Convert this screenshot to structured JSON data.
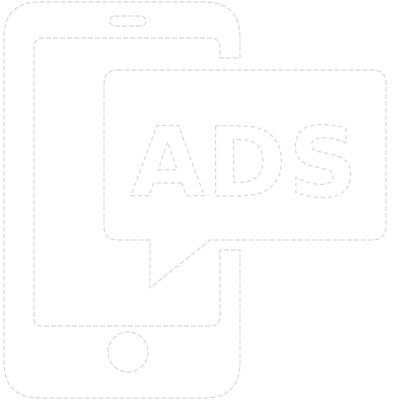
{
  "icon": {
    "name": "mobile-ads-icon",
    "label": "ADS",
    "colors": {
      "background": "#ffffff",
      "fill": "#ffffff",
      "outline": "#d8d8d8"
    }
  }
}
